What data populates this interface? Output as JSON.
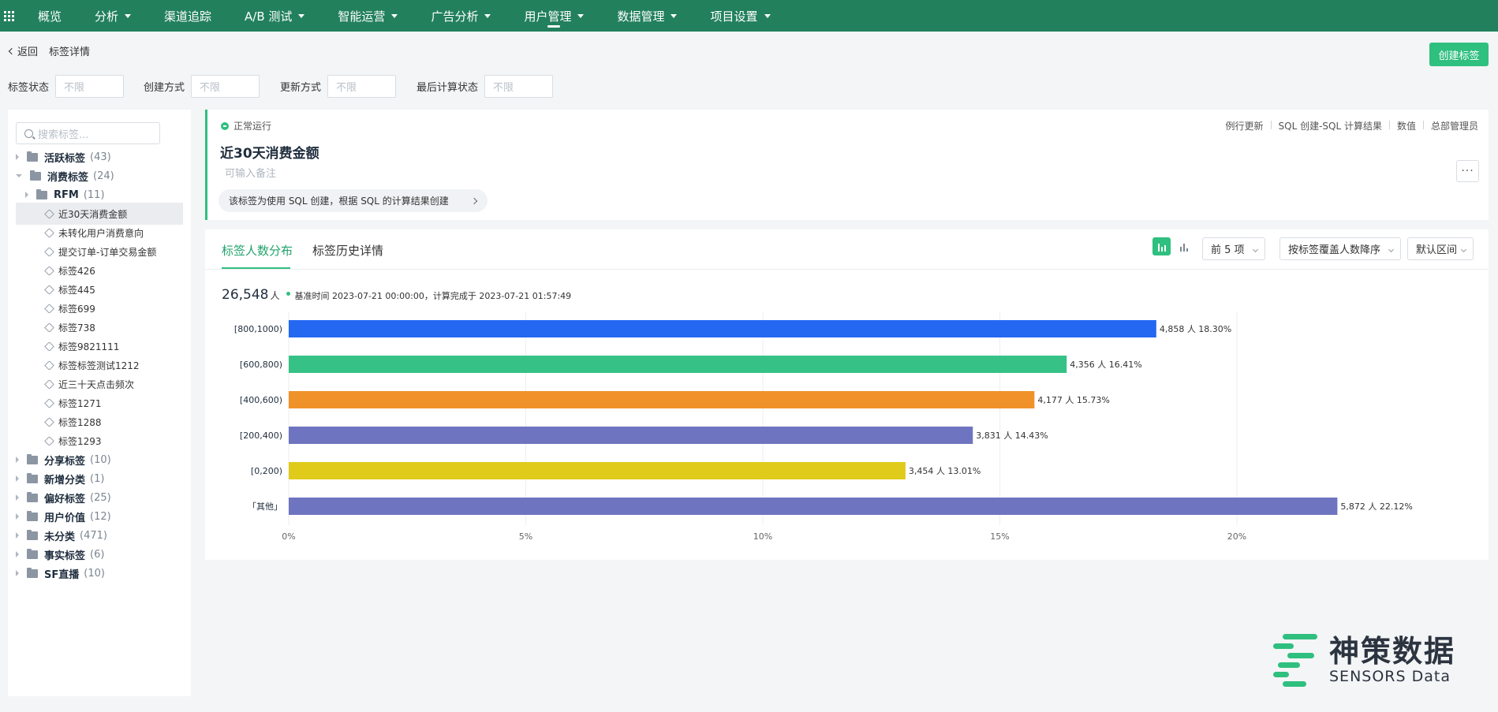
{
  "nav": {
    "items": [
      {
        "label": "概览",
        "dropdown": false,
        "active": false
      },
      {
        "label": "分析",
        "dropdown": true,
        "active": false
      },
      {
        "label": "渠道追踪",
        "dropdown": false,
        "active": false
      },
      {
        "label": "A/B 测试",
        "dropdown": true,
        "active": false
      },
      {
        "label": "智能运营",
        "dropdown": true,
        "active": false
      },
      {
        "label": "广告分析",
        "dropdown": true,
        "active": false
      },
      {
        "label": "用户管理",
        "dropdown": true,
        "active": true
      },
      {
        "label": "数据管理",
        "dropdown": true,
        "active": false
      },
      {
        "label": "项目设置",
        "dropdown": true,
        "active": false
      }
    ]
  },
  "header": {
    "back_label": "返回",
    "title": "标签详情",
    "create_button": "创建标签"
  },
  "filters": [
    {
      "label": "标签状态",
      "placeholder": "不限"
    },
    {
      "label": "创建方式",
      "placeholder": "不限"
    },
    {
      "label": "更新方式",
      "placeholder": "不限"
    },
    {
      "label": "最后计算状态",
      "placeholder": "不限"
    }
  ],
  "sidebar": {
    "search_placeholder": "搜索标签...",
    "tree": [
      {
        "type": "folder",
        "label": "活跃标签",
        "count": "(43)",
        "expanded": false,
        "level": 0
      },
      {
        "type": "folder",
        "label": "消费标签",
        "count": "(24)",
        "expanded": true,
        "level": 0
      },
      {
        "type": "folder",
        "label": "RFM",
        "count": "(11)",
        "expanded": false,
        "level": 1
      },
      {
        "type": "leaf",
        "label": "近30天消费金额",
        "selected": true
      },
      {
        "type": "leaf",
        "label": "未转化用户消费意向"
      },
      {
        "type": "leaf",
        "label": "提交订单-订单交易金额"
      },
      {
        "type": "leaf",
        "label": "标签426"
      },
      {
        "type": "leaf",
        "label": "标签445"
      },
      {
        "type": "leaf",
        "label": "标签699"
      },
      {
        "type": "leaf",
        "label": "标签738"
      },
      {
        "type": "leaf",
        "label": "标签9821111"
      },
      {
        "type": "leaf",
        "label": "标签标签测试1212"
      },
      {
        "type": "leaf",
        "label": "近三十天点击频次"
      },
      {
        "type": "leaf",
        "label": "标签1271"
      },
      {
        "type": "leaf",
        "label": "标签1288"
      },
      {
        "type": "leaf",
        "label": "标签1293"
      },
      {
        "type": "folder",
        "label": "分享标签",
        "count": "(10)",
        "expanded": false,
        "level": 0
      },
      {
        "type": "folder",
        "label": "新增分类",
        "count": "(1)",
        "expanded": false,
        "level": 0
      },
      {
        "type": "folder",
        "label": "偏好标签",
        "count": "(25)",
        "expanded": false,
        "level": 0
      },
      {
        "type": "folder",
        "label": "用户价值",
        "count": "(12)",
        "expanded": false,
        "level": 0
      },
      {
        "type": "folder",
        "label": "未分类",
        "count": "(471)",
        "expanded": false,
        "level": 0
      },
      {
        "type": "folder",
        "label": "事实标签",
        "count": "(6)",
        "expanded": false,
        "level": 0
      },
      {
        "type": "folder",
        "label": "SF直播",
        "count": "(10)",
        "expanded": false,
        "level": 0
      }
    ]
  },
  "tag": {
    "status": "正常运行",
    "meta": [
      "例行更新",
      "SQL 创建-SQL 计算结果",
      "数值",
      "总部管理员"
    ],
    "name": "近30天消费金额",
    "note_placeholder": "可输入备注",
    "description": "该标签为使用 SQL 创建，根据 SQL 的计算结果创建",
    "more_label": "···"
  },
  "tabs": [
    {
      "label": "标签人数分布",
      "active": true
    },
    {
      "label": "标签历史详情",
      "active": false
    }
  ],
  "controls": {
    "topn": "前 5 项",
    "sort": "按标签覆盖人数降序",
    "range": "默认区间"
  },
  "summary": {
    "total": "26,548",
    "unit": "人",
    "time_text": "基准时间 2023-07-21 00:00:00，计算完成于 2023-07-21 01:57:49"
  },
  "colors": {
    "accent": "#2fbf7f",
    "nav_bg": "#22805d"
  },
  "chart_data": {
    "type": "bar",
    "orientation": "horizontal",
    "categories": [
      "[800,1000)",
      "[600,800)",
      "[400,600)",
      "[200,400)",
      "[0,200)",
      "「其他」"
    ],
    "values": [
      18.3,
      16.41,
      15.73,
      14.43,
      13.01,
      22.12
    ],
    "counts": [
      4858,
      4356,
      4177,
      3831,
      3454,
      5872
    ],
    "labels": [
      "4,858 人 18.30%",
      "4,356 人 16.41%",
      "4,177 人 15.73%",
      "3,831 人 14.43%",
      "3,454 人 13.01%",
      "5,872 人 22.12%"
    ],
    "colors": [
      "#2468f2",
      "#36c286",
      "#f0922a",
      "#6f74c0",
      "#e0cb1a",
      "#6f74c0"
    ],
    "xticks": [
      "0%",
      "5%",
      "10%",
      "15%",
      "20%"
    ],
    "xlim": [
      0,
      22.5
    ],
    "grid": true
  }
}
